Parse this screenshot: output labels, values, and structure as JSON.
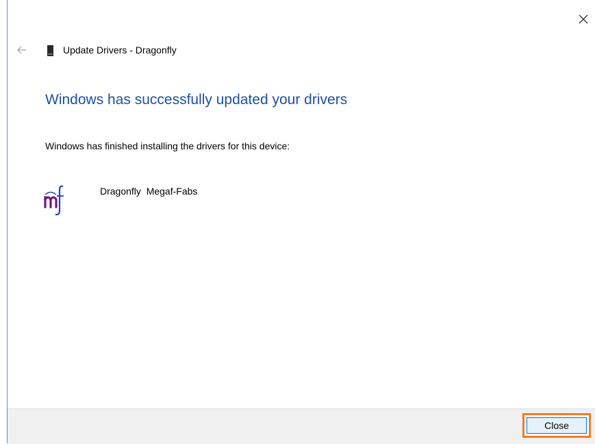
{
  "window": {
    "title": "Update Drivers - Dragonfly",
    "close_icon": "close-icon",
    "back_icon": "back-arrow-icon"
  },
  "content": {
    "heading": "Windows has successfully updated your drivers",
    "info": "Windows has finished installing the drivers for this device:",
    "device": {
      "name": "Dragonfly  Megaf-Fabs",
      "icon": "megaf-fabs-logo-icon"
    }
  },
  "footer": {
    "close_label": "Close"
  },
  "colors": {
    "heading": "#1f4e9e",
    "highlight": "#ef7d22",
    "button_border": "#0078d7",
    "button_bg": "#e5f1fb",
    "footer_bg": "#f0f0f0",
    "logo_m": "#6a1b7d",
    "logo_f": "#1f3ec8"
  }
}
